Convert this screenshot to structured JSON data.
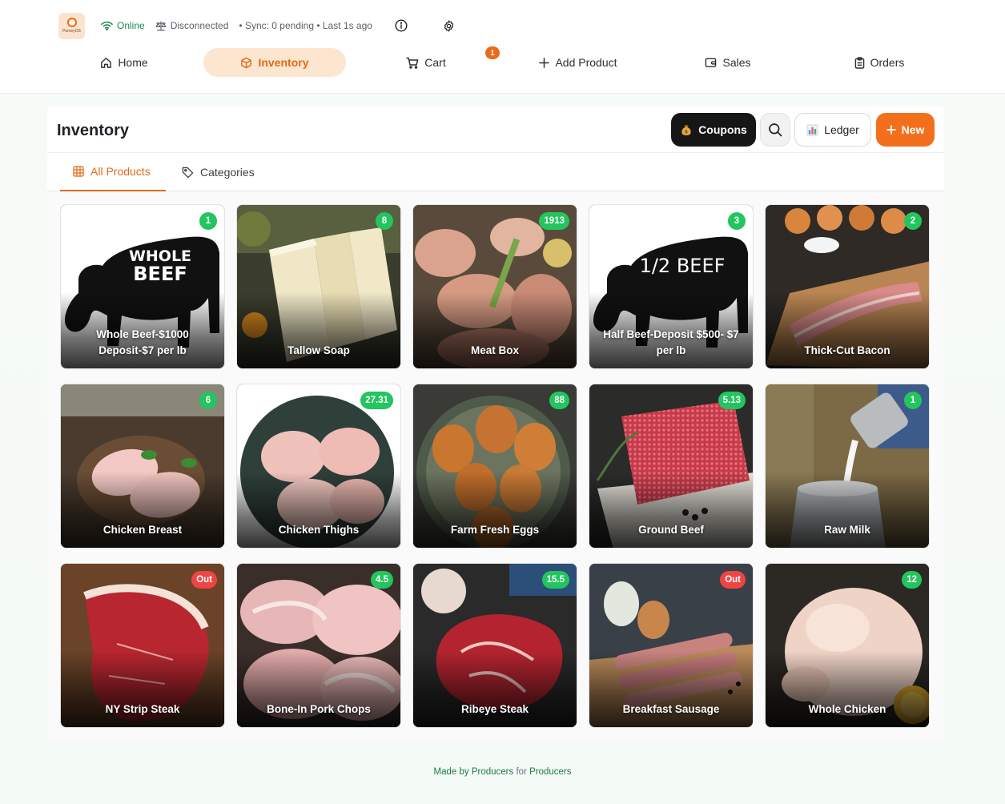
{
  "app": {
    "logo_text": "PurveyOS",
    "status": {
      "online": "Online",
      "scale": "Disconnected",
      "sync": "• Sync: 0 pending • Last 1s ago"
    }
  },
  "nav": {
    "home": "Home",
    "inventory": "Inventory",
    "cart": "Cart",
    "cart_count": "1",
    "add_product": "Add Product",
    "sales": "Sales",
    "orders": "Orders"
  },
  "page": {
    "title": "Inventory",
    "buttons": {
      "coupons": "Coupons",
      "ledger": "Ledger",
      "new": "New"
    },
    "tabs": {
      "all_products": "All Products",
      "categories": "Categories"
    }
  },
  "products": [
    {
      "name": "Whole Beef-$1000 Deposit-$7 per lb",
      "badge": "1",
      "status": "in",
      "art": "whole-beef",
      "art_text_1": "WHOLE",
      "art_text_2": "BEEF"
    },
    {
      "name": "Tallow Soap",
      "badge": "8",
      "status": "in",
      "art": "soap"
    },
    {
      "name": "Meat Box",
      "badge": "1913",
      "status": "in",
      "art": "meatbox"
    },
    {
      "name": "Half Beef-Deposit $500- $7 per lb",
      "badge": "3",
      "status": "in",
      "art": "half-beef",
      "art_text_1": "1/2 BEEF"
    },
    {
      "name": "Thick-Cut Bacon",
      "badge": "2",
      "status": "in",
      "art": "bacon"
    },
    {
      "name": "Chicken Breast",
      "badge": "6",
      "status": "in",
      "art": "breast"
    },
    {
      "name": "Chicken Thighs",
      "badge": "27.31",
      "status": "in",
      "art": "thighs"
    },
    {
      "name": "Farm Fresh Eggs",
      "badge": "88",
      "status": "in",
      "art": "eggs"
    },
    {
      "name": "Ground Beef",
      "badge": "5.13",
      "status": "in",
      "art": "ground"
    },
    {
      "name": "Raw Milk",
      "badge": "1",
      "status": "in",
      "art": "milk"
    },
    {
      "name": "NY Strip Steak",
      "badge": "Out",
      "status": "out",
      "art": "strip"
    },
    {
      "name": "Bone-In Pork Chops",
      "badge": "4.5",
      "status": "in",
      "art": "pork"
    },
    {
      "name": "Ribeye Steak",
      "badge": "15.5",
      "status": "in",
      "art": "ribeye"
    },
    {
      "name": "Breakfast Sausage",
      "badge": "Out",
      "status": "out",
      "art": "sausage"
    },
    {
      "name": "Whole Chicken",
      "badge": "12",
      "status": "in",
      "art": "chicken"
    }
  ],
  "footer": {
    "made_by": "Made by",
    "producers_1": "Producers",
    "for": "for",
    "producers_2": "Producers"
  },
  "colors": {
    "accent": "#f36f1c",
    "in_stock": "#22c55e",
    "out_of_stock": "#ef4444",
    "online": "#1a8a52"
  }
}
